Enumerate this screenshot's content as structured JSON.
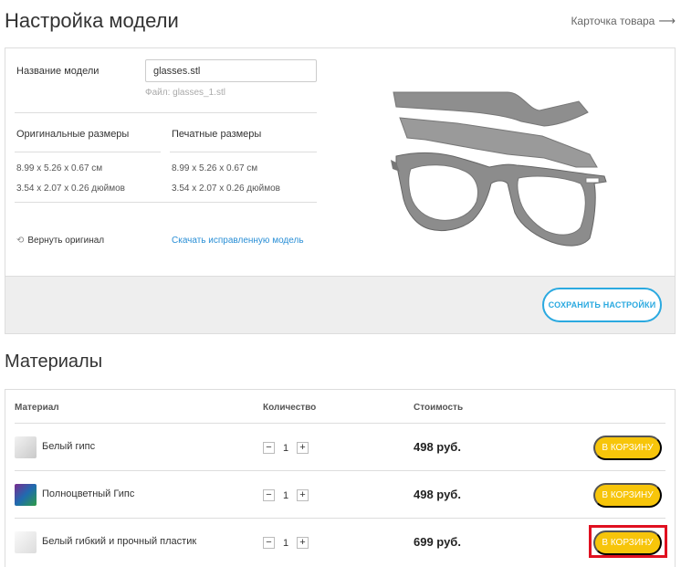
{
  "header": {
    "title": "Настройка модели",
    "product_link": "Карточка товара",
    "product_link_icon": "arrow-right-icon"
  },
  "model": {
    "name_label": "Название модели",
    "name_value": "glasses.stl",
    "file_hint": "Файл: glasses_1.stl",
    "original_label": "Оригинальные размеры",
    "print_label": "Печатные размеры",
    "original_cm": "8.99 x 5.26 x 0.67 см",
    "original_in": "3.54 x 2.07 x 0.26 дюймов",
    "print_cm": "8.99 x 5.26 x 0.67 см",
    "print_in": "3.54 x 2.07 x 0.26 дюймов",
    "revert_label": "Вернуть оригинал",
    "revert_icon": "undo-icon",
    "download_label": "Скачать исправленную модель",
    "save_label": "СОХРАНИТЬ НАСТРОЙКИ"
  },
  "materials": {
    "title": "Материалы",
    "columns": {
      "material": "Материал",
      "quantity": "Количество",
      "cost": "Стоимость"
    },
    "rows": [
      {
        "name": "Белый гипс",
        "qty": "1",
        "price": "498 руб.",
        "cart": "В КОРЗИНУ",
        "minus": "−",
        "plus": "+"
      },
      {
        "name": "Полноцветный Гипс",
        "qty": "1",
        "price": "498 руб.",
        "cart": "В КОРЗИНУ",
        "minus": "−",
        "plus": "+"
      },
      {
        "name": "Белый гибкий и прочный пластик",
        "qty": "1",
        "price": "699 руб.",
        "cart": "В КОРЗИНУ",
        "minus": "−",
        "plus": "+"
      }
    ]
  },
  "colors": {
    "accent_blue": "#2aa9e0",
    "cart_yellow": "#f7c50a",
    "highlight_red": "#e01020"
  }
}
